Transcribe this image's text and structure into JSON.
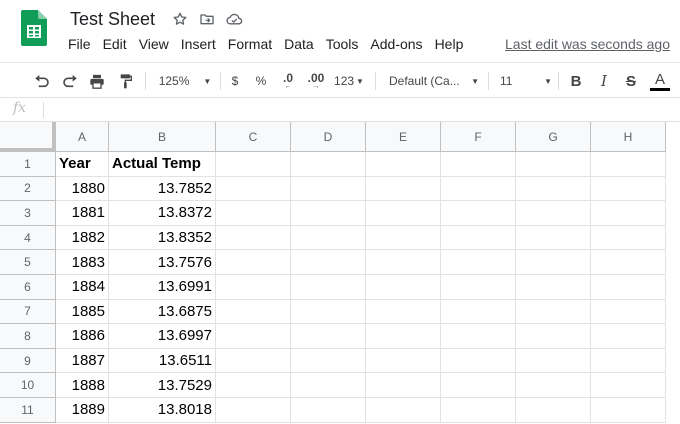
{
  "app": {
    "title": "Test Sheet",
    "icons": [
      "star-icon",
      "move-to-folder-icon",
      "cloud-saved-icon"
    ],
    "brand_color": "#0f9d58"
  },
  "menu": {
    "items": [
      "File",
      "Edit",
      "View",
      "Insert",
      "Format",
      "Data",
      "Tools",
      "Add-ons",
      "Help"
    ],
    "last_edit": "Last edit was seconds ago"
  },
  "toolbar": {
    "zoom": "125%",
    "currency": "$",
    "percent": "%",
    "decrease_decimal": ".0",
    "increase_decimal": ".00",
    "more_formats": "123",
    "font": "Default (Ca...",
    "font_size": "11",
    "bold": "B",
    "italic": "I",
    "strikethrough": "S",
    "text_color": "A"
  },
  "formula_bar": {
    "fx_label": "fx",
    "value": ""
  },
  "grid": {
    "columns": [
      "A",
      "B",
      "C",
      "D",
      "E",
      "F",
      "G",
      "H"
    ],
    "rows": [
      {
        "n": "1",
        "cells": [
          "Year",
          "Actual Temp"
        ]
      },
      {
        "n": "2",
        "cells": [
          "1880",
          "13.7852"
        ]
      },
      {
        "n": "3",
        "cells": [
          "1881",
          "13.8372"
        ]
      },
      {
        "n": "4",
        "cells": [
          "1882",
          "13.8352"
        ]
      },
      {
        "n": "5",
        "cells": [
          "1883",
          "13.7576"
        ]
      },
      {
        "n": "6",
        "cells": [
          "1884",
          "13.6991"
        ]
      },
      {
        "n": "7",
        "cells": [
          "1885",
          "13.6875"
        ]
      },
      {
        "n": "8",
        "cells": [
          "1886",
          "13.6997"
        ]
      },
      {
        "n": "9",
        "cells": [
          "1887",
          "13.6511"
        ]
      },
      {
        "n": "10",
        "cells": [
          "1888",
          "13.7529"
        ]
      },
      {
        "n": "11",
        "cells": [
          "1889",
          "13.8018"
        ]
      }
    ]
  }
}
